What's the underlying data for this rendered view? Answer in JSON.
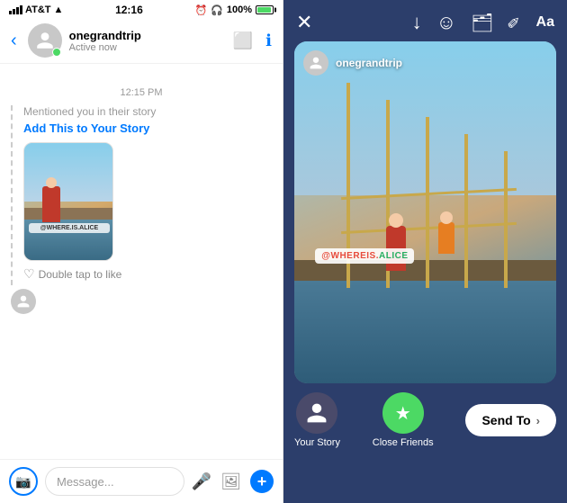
{
  "status_bar": {
    "carrier": "AT&T",
    "time": "12:16",
    "battery": "100%"
  },
  "left": {
    "header": {
      "name": "onegrandtrip",
      "status": "Active now",
      "back_label": "‹"
    },
    "chat": {
      "timestamp": "12:15 PM",
      "mention_text": "Mentioned you in their story",
      "add_story_link": "Add This to Your Story",
      "like_hint": "Double tap to like",
      "sticker_text": "@WHERE.IS.ALICE"
    },
    "input": {
      "placeholder": "Message..."
    }
  },
  "right": {
    "toolbar": {
      "close_icon": "✕",
      "download_icon": "↓",
      "sticker_face_icon": "☺",
      "sticker_icon": "⬜",
      "pen_icon": "✏",
      "text_icon": "Aa"
    },
    "story": {
      "username": "onegrandtrip",
      "sticker": "@WHEREIS.ALICE"
    },
    "bottom": {
      "your_story_label": "Your Story",
      "close_friends_label": "Close Friends",
      "send_to_label": "Send To",
      "chevron": "›"
    }
  }
}
